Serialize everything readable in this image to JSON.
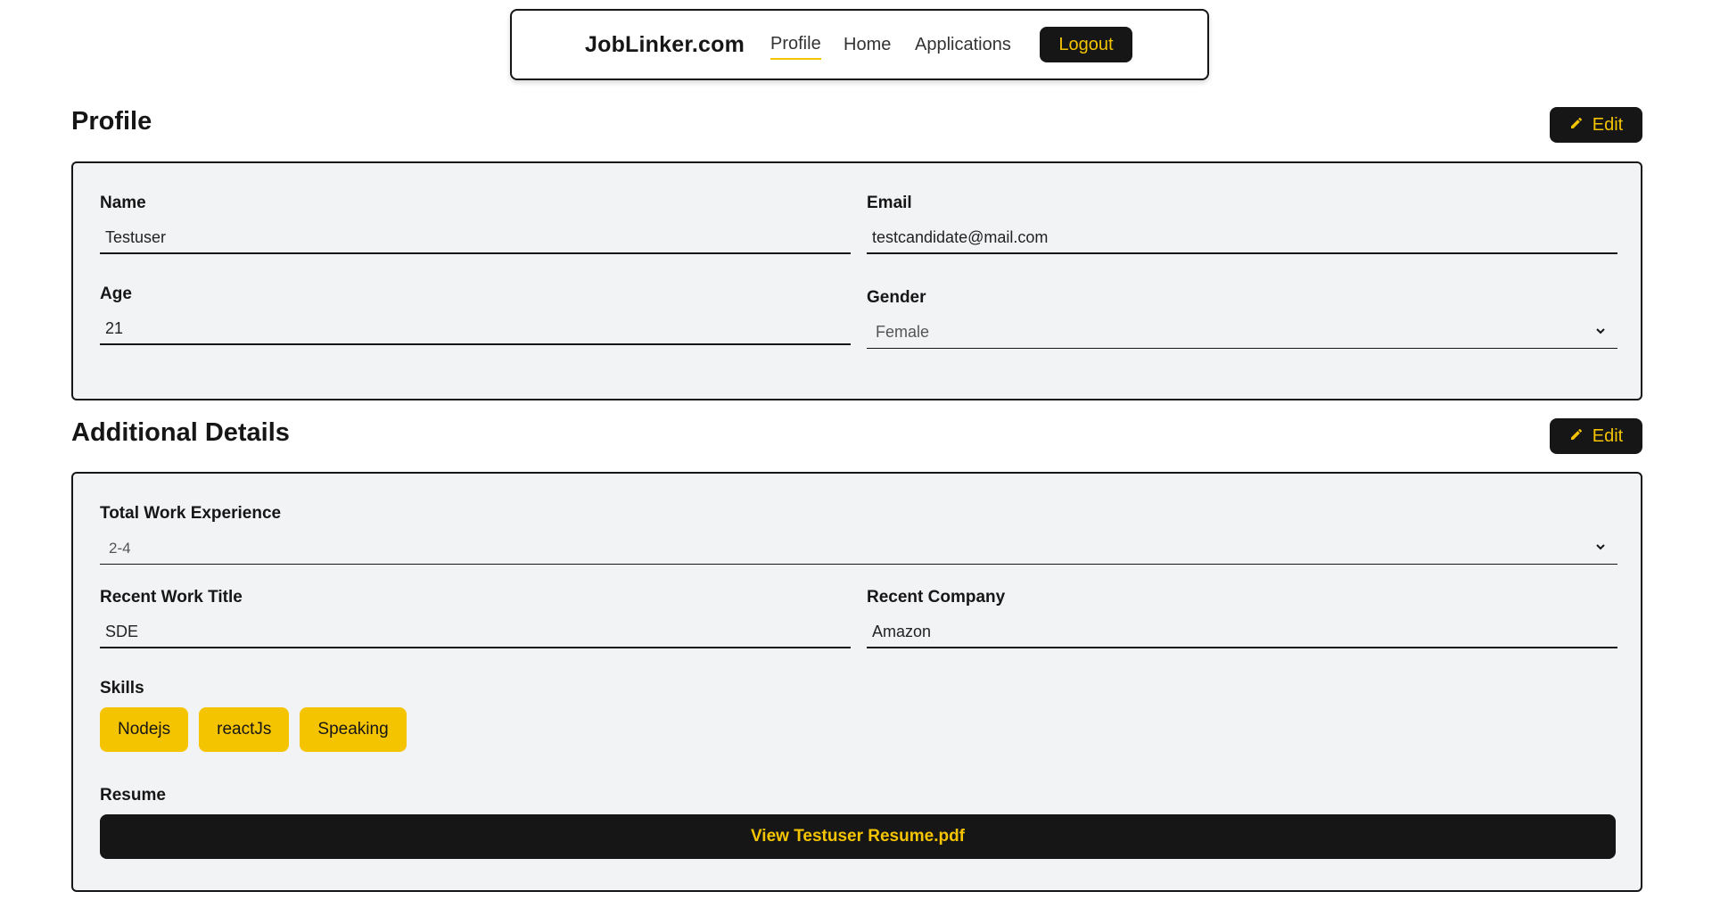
{
  "nav": {
    "brand": "JobLinker.com",
    "links": [
      "Profile",
      "Home",
      "Applications"
    ],
    "logout": "Logout"
  },
  "profile": {
    "title": "Profile",
    "edit_label": "Edit",
    "name_label": "Name",
    "name_value": "Testuser",
    "email_label": "Email",
    "email_value": "testcandidate@mail.com",
    "age_label": "Age",
    "age_value": "21",
    "gender_label": "Gender",
    "gender_value": "Female"
  },
  "additional": {
    "title": "Additional Details",
    "edit_label": "Edit",
    "experience_label": "Total Work Experience",
    "experience_value": "2-4",
    "work_title_label": "Recent Work Title",
    "work_title_value": "SDE",
    "company_label": "Recent Company",
    "company_value": "Amazon",
    "skills_label": "Skills",
    "skills": [
      "Nodejs",
      "reactJs",
      "Speaking"
    ],
    "resume_label": "Resume",
    "resume_button": "View Testuser Resume.pdf"
  },
  "colors": {
    "accent": "#f5c400",
    "dark": "#161616",
    "card_bg": "#f2f3f5"
  }
}
